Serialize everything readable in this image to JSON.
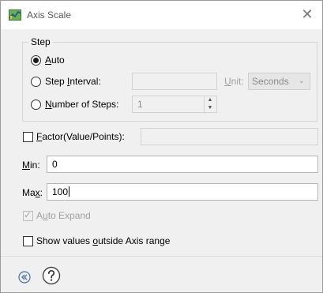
{
  "window": {
    "title": "Axis Scale",
    "close_glyph": "✕"
  },
  "step": {
    "group_label": "Step",
    "auto_label": "Auto",
    "auto_mnemonic": "A",
    "auto_rest": "uto",
    "step_interval_label_pre": "Step ",
    "step_interval_mnemonic": "I",
    "step_interval_label_post": "nterval:",
    "step_interval_value": "",
    "unit_label_mnemonic": "U",
    "unit_label_rest": "nit:",
    "unit_value": "Seconds",
    "number_of_steps_mnemonic": "N",
    "number_of_steps_rest": "umber of Steps:",
    "number_of_steps_value": "1"
  },
  "factor": {
    "label_mnemonic": "F",
    "label_rest": "actor(Value/Points):",
    "value": "",
    "checked": false
  },
  "min": {
    "label_mnemonic": "M",
    "label_rest": "in:",
    "value": "0"
  },
  "max": {
    "label_pre": "Ma",
    "label_mnemonic": "x",
    "label_post": ":",
    "value": "100"
  },
  "auto_expand": {
    "label_pre": "A",
    "label_mnemonic": "u",
    "label_post": "to Expand",
    "checked": true,
    "enabled": false
  },
  "show_outside": {
    "label_pre": "Show values ",
    "label_mnemonic": "o",
    "label_post": "utside Axis range",
    "checked": false
  },
  "footer": {
    "collapse_icon": "double-chevron-left-icon",
    "help_icon": "help-icon"
  }
}
